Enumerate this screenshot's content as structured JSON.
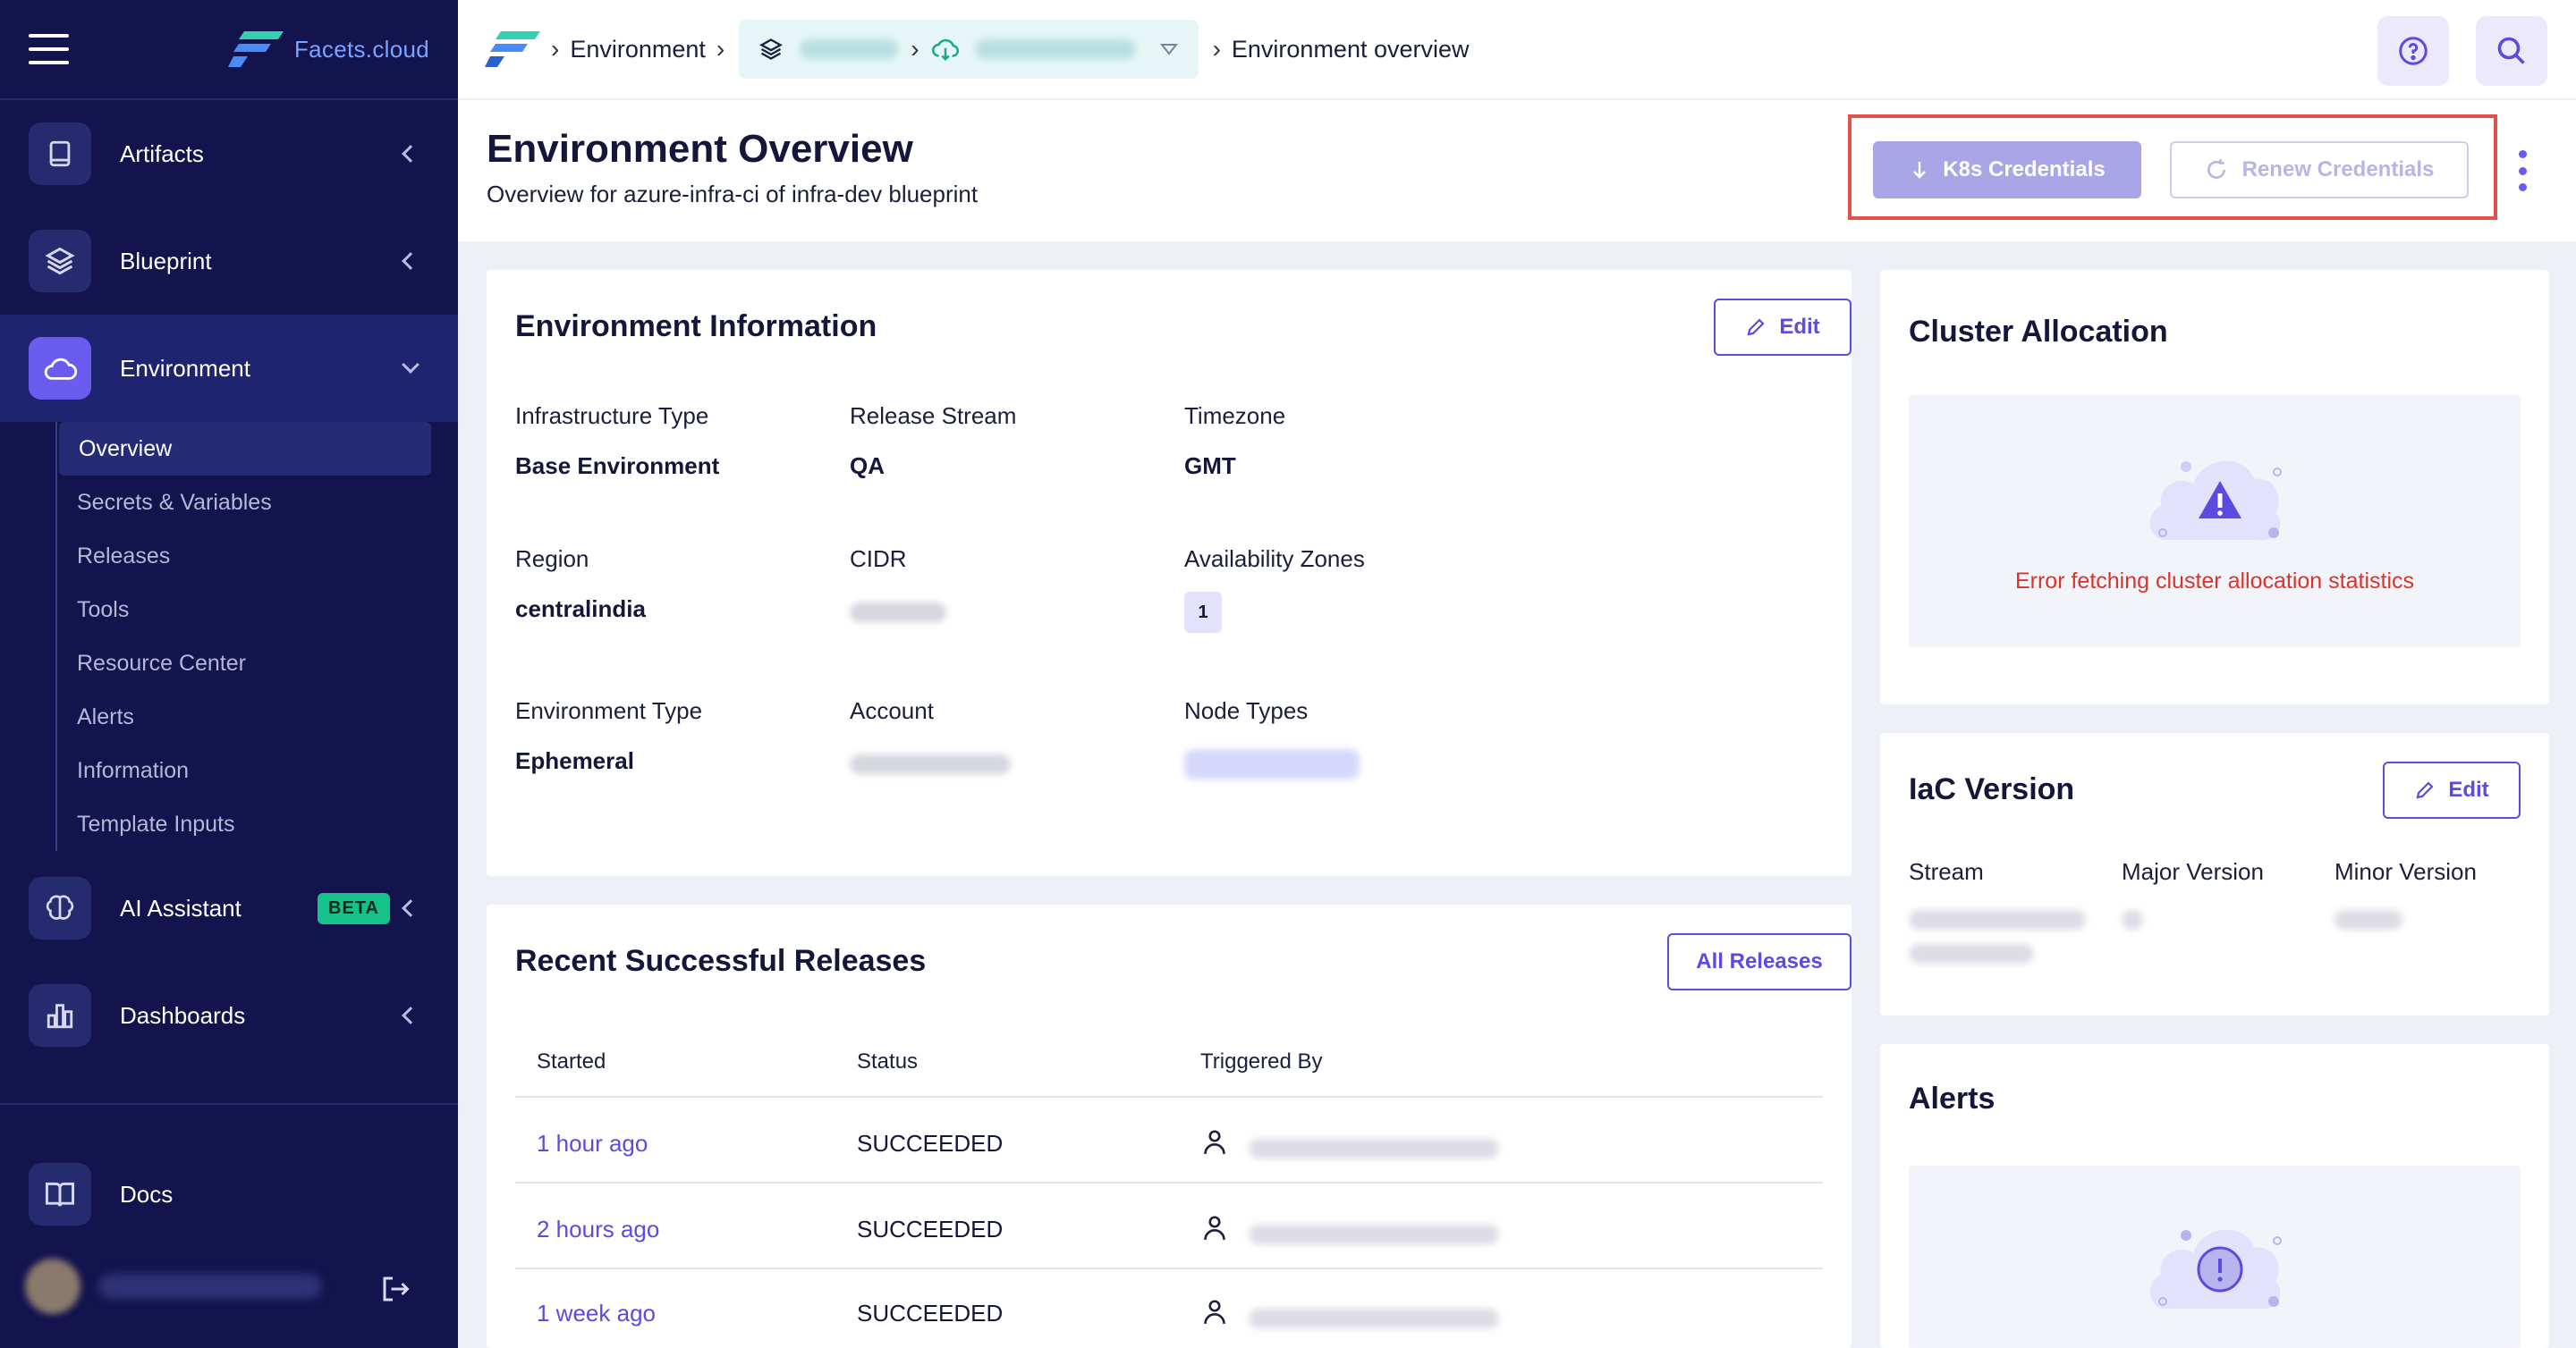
{
  "sidebar": {
    "brand": "Facets.cloud",
    "nav": [
      {
        "label": "Artifacts",
        "icon": "book-icon"
      },
      {
        "label": "Blueprint",
        "icon": "layers-icon"
      },
      {
        "label": "Environment",
        "icon": "cloud-icon",
        "active": true
      },
      {
        "label": "AI Assistant",
        "icon": "brain-icon",
        "badge": "BETA"
      },
      {
        "label": "Dashboards",
        "icon": "bar-chart-icon"
      },
      {
        "label": "Docs",
        "icon": "open-book-icon"
      }
    ],
    "sub_nav": [
      "Overview",
      "Secrets & Variables",
      "Releases",
      "Tools",
      "Resource Center",
      "Alerts",
      "Information",
      "Template Inputs"
    ]
  },
  "topbar": {
    "crumbs": [
      "Environment",
      "Environment overview"
    ]
  },
  "header": {
    "title": "Environment Overview",
    "subtitle": "Overview for azure-infra-ci of infra-dev blueprint",
    "k8s_button": "K8s Credentials",
    "renew_button": "Renew Credentials"
  },
  "env_info": {
    "title": "Environment Information",
    "edit": "Edit",
    "fields": {
      "infra_type_label": "Infrastructure Type",
      "infra_type_value": "Base Environment",
      "release_stream_label": "Release Stream",
      "release_stream_value": "QA",
      "timezone_label": "Timezone",
      "timezone_value": "GMT",
      "region_label": "Region",
      "region_value": "centralindia",
      "cidr_label": "CIDR",
      "az_label": "Availability Zones",
      "az_value": "1",
      "env_type_label": "Environment Type",
      "env_type_value": "Ephemeral",
      "account_label": "Account",
      "node_types_label": "Node Types"
    }
  },
  "releases": {
    "title": "Recent Successful Releases",
    "all_button": "All Releases",
    "columns": [
      "Started",
      "Status",
      "Triggered By"
    ],
    "rows": [
      {
        "started": "1 hour ago",
        "status": "SUCCEEDED"
      },
      {
        "started": "2 hours ago",
        "status": "SUCCEEDED"
      },
      {
        "started": "1 week ago",
        "status": "SUCCEEDED"
      }
    ]
  },
  "cluster": {
    "title": "Cluster Allocation",
    "error": "Error fetching cluster allocation statistics"
  },
  "iac": {
    "title": "IaC Version",
    "edit": "Edit",
    "columns": [
      "Stream",
      "Major Version",
      "Minor Version"
    ]
  },
  "alerts": {
    "title": "Alerts"
  },
  "colors": {
    "sidebar_bg": "#13134d",
    "accent": "#5b4be0",
    "error": "#d9342b",
    "highlight": "#e2524a"
  }
}
